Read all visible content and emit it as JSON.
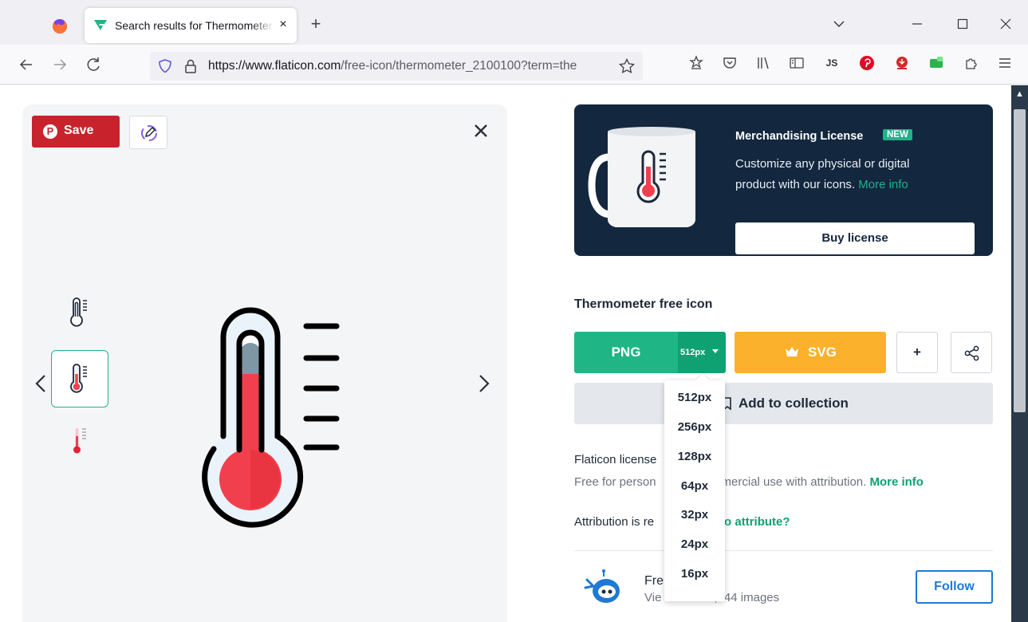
{
  "browser": {
    "tab_title": "Search results for Thermometer",
    "tab_close": "×",
    "new_tab": "+",
    "url_host": "https://www.flaticon.com",
    "url_path": "/free-icon/thermometer_2100100?term=the",
    "ext_js": "JS"
  },
  "preview": {
    "save_label": "Save",
    "save_letter": "P"
  },
  "merch": {
    "title": "Merchandising License",
    "badge": "NEW",
    "desc": "Customize any physical or digital product with our icons.",
    "more_info": "More info",
    "buy_label": "Buy license"
  },
  "icon": {
    "title": "Thermometer free icon",
    "png_label": "PNG",
    "size_selected": "512px",
    "svg_label": "SVG",
    "plus_label": "+",
    "collection_label": "Add to collection"
  },
  "license": {
    "title": "Flaticon license",
    "desc_pre": "Free for person",
    "desc_mid": "mercial use with attribution.",
    "more_info": "More info",
    "attr_pre": "Attribution is re",
    "attr_link": "ow to attribute?"
  },
  "author": {
    "name": "Fre",
    "meta_pre": "Vie",
    "meta_post": ",544 images",
    "follow_label": "Follow"
  },
  "size_options": [
    "512px",
    "256px",
    "128px",
    "64px",
    "32px",
    "24px",
    "16px"
  ],
  "colors": {
    "accent_green": "#20b585",
    "svg_orange": "#fbb12b",
    "merch_navy": "#13273f",
    "pinterest_red": "#c8232c",
    "follow_blue": "#1d7ad6"
  }
}
